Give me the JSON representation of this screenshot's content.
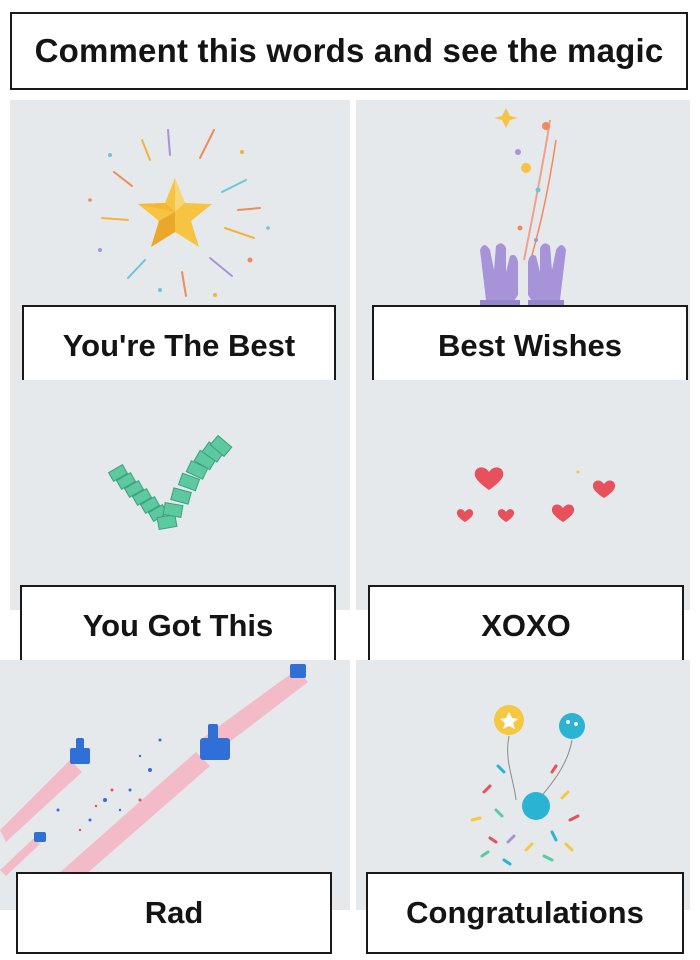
{
  "header": {
    "title": "Comment this words and see the magic"
  },
  "cards": [
    {
      "label": "You're The Best",
      "icon": "star-icon"
    },
    {
      "label": "Best Wishes",
      "icon": "praying-hands-icon"
    },
    {
      "label": "You Got This",
      "icon": "checkmark-icon"
    },
    {
      "label": "XOXO",
      "icon": "hearts-icon"
    },
    {
      "label": "Rad",
      "icon": "thumbs-up-rockets-icon"
    },
    {
      "label": "Congratulations",
      "icon": "balloons-confetti-icon"
    }
  ],
  "colors": {
    "panel_bg": "#e6e9ec",
    "star": "#f6c343",
    "hands": "#a794d8",
    "check": "#5cc9a0",
    "heart": "#e8505b",
    "thumb": "#2f6fd6",
    "balloon_yellow": "#f5c842",
    "balloon_cyan": "#2bb3d4"
  }
}
